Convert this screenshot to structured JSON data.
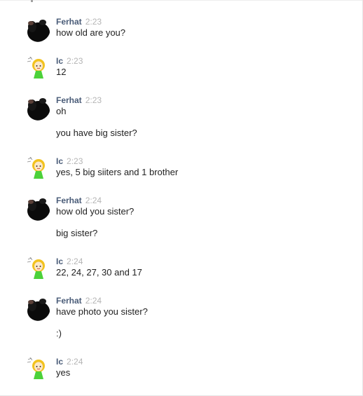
{
  "chat": {
    "messages": [
      {
        "author": "Ferhat",
        "avatar": "dark-photo-avatar",
        "time": "2:23",
        "lines": [
          "how old are you?"
        ]
      },
      {
        "author": "Ic",
        "avatar": "cartoon-girl-avatar",
        "time": "2:23",
        "lines": [
          "12"
        ]
      },
      {
        "author": "Ferhat",
        "avatar": "dark-photo-avatar",
        "time": "2:23",
        "lines": [
          "oh",
          "you have big sister?"
        ]
      },
      {
        "author": "Ic",
        "avatar": "cartoon-girl-avatar",
        "time": "2:23",
        "lines": [
          "yes, 5 big siiters and 1 brother"
        ]
      },
      {
        "author": "Ferhat",
        "avatar": "dark-photo-avatar",
        "time": "2:24",
        "lines": [
          "how old you sister?",
          "big sister?"
        ]
      },
      {
        "author": "Ic",
        "avatar": "cartoon-girl-avatar",
        "time": "2:24",
        "lines": [
          "22, 24, 27, 30 and 17"
        ]
      },
      {
        "author": "Ferhat",
        "avatar": "dark-photo-avatar",
        "time": "2:24",
        "lines": [
          "have photo you sister?",
          ":)"
        ]
      },
      {
        "author": "Ic",
        "avatar": "cartoon-girl-avatar",
        "time": "2:24",
        "lines": [
          "yes"
        ]
      }
    ]
  },
  "colors": {
    "author": "#4a5c78",
    "timestamp": "#b5b5b5",
    "text": "#222222",
    "avatar_girl_dress": "#4cd13a",
    "avatar_girl_hair": "#f2c21f"
  }
}
